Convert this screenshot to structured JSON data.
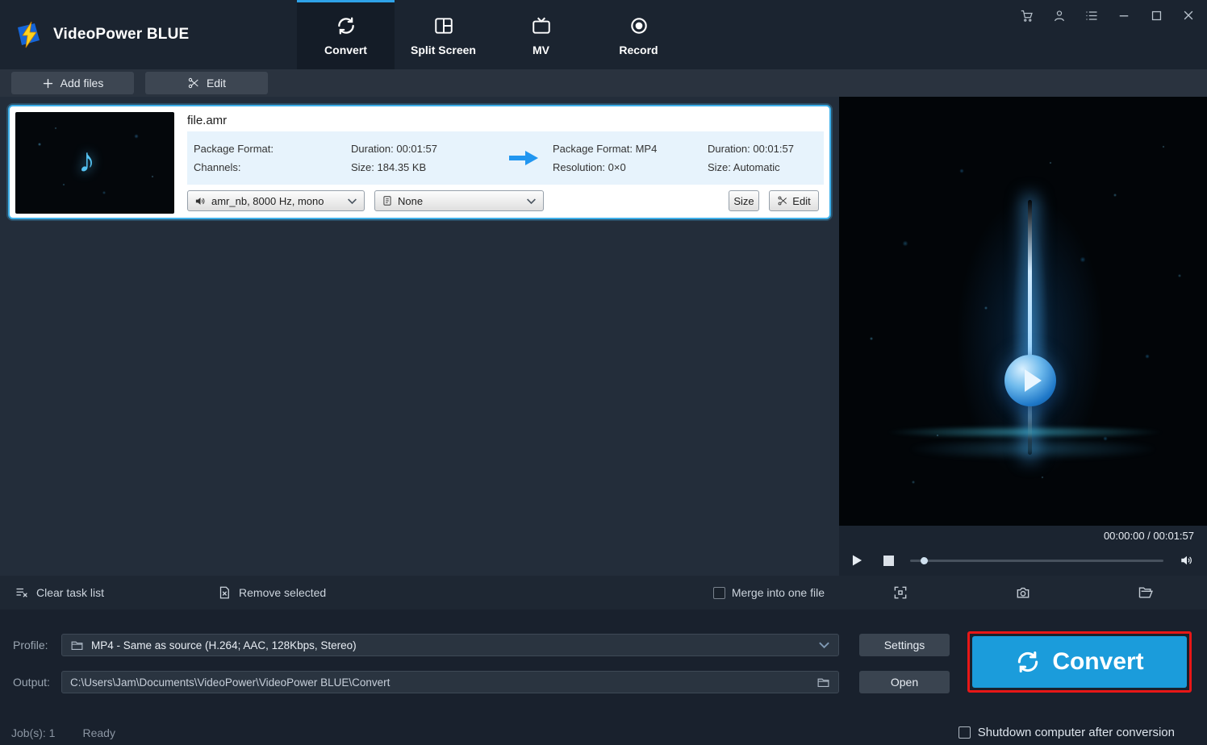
{
  "app": {
    "title": "VideoPower BLUE"
  },
  "tabs": [
    {
      "label": "Convert",
      "active": true
    },
    {
      "label": "Split Screen",
      "active": false
    },
    {
      "label": "MV",
      "active": false
    },
    {
      "label": "Record",
      "active": false
    }
  ],
  "toolbar": {
    "add_files_label": "Add files",
    "edit_label": "Edit"
  },
  "file": {
    "name": "file.amr",
    "source": {
      "package_format_label": "Package Format:",
      "channels_label": "Channels:",
      "duration": "Duration: 00:01:57",
      "size": "Size: 184.35 KB"
    },
    "target": {
      "package_format": "Package Format: MP4",
      "resolution": "Resolution: 0×0",
      "duration": "Duration: 00:01:57",
      "size": "Size: Automatic"
    },
    "audio_track": "amr_nb, 8000 Hz, mono",
    "subtitle": "None",
    "size_button": "Size",
    "edit_button": "Edit"
  },
  "taskbar": {
    "clear_label": "Clear task list",
    "remove_label": "Remove selected",
    "merge_label": "Merge into one file"
  },
  "preview": {
    "time": "00:00:00 / 00:01:57"
  },
  "bottom": {
    "profile_label": "Profile:",
    "profile_value": "MP4 - Same as source (H.264; AAC, 128Kbps, Stereo)",
    "settings_label": "Settings",
    "output_label": "Output:",
    "output_value": "C:\\Users\\Jam\\Documents\\VideoPower\\VideoPower BLUE\\Convert",
    "open_label": "Open",
    "convert_label": "Convert",
    "jobs_label": "Job(s): 1",
    "status": "Ready",
    "shutdown_label": "Shutdown computer after conversion"
  },
  "colors": {
    "accent_blue": "#2ea2e8",
    "convert_button_blue": "#1b9cdb",
    "highlight_red": "#e81717",
    "selection_border": "#3fb0ea",
    "info_box_bg": "#e7f3fc"
  },
  "icons": {
    "logo": "lightning-bolt",
    "convert_tab": "refresh-arrows",
    "split_screen_tab": "split-rectangle",
    "mv_tab": "tv",
    "record_tab": "record-dot",
    "audio_track": "speaker",
    "subtitle": "document",
    "edit": "scissors",
    "snapshot": "camera",
    "open_folder": "folder"
  }
}
